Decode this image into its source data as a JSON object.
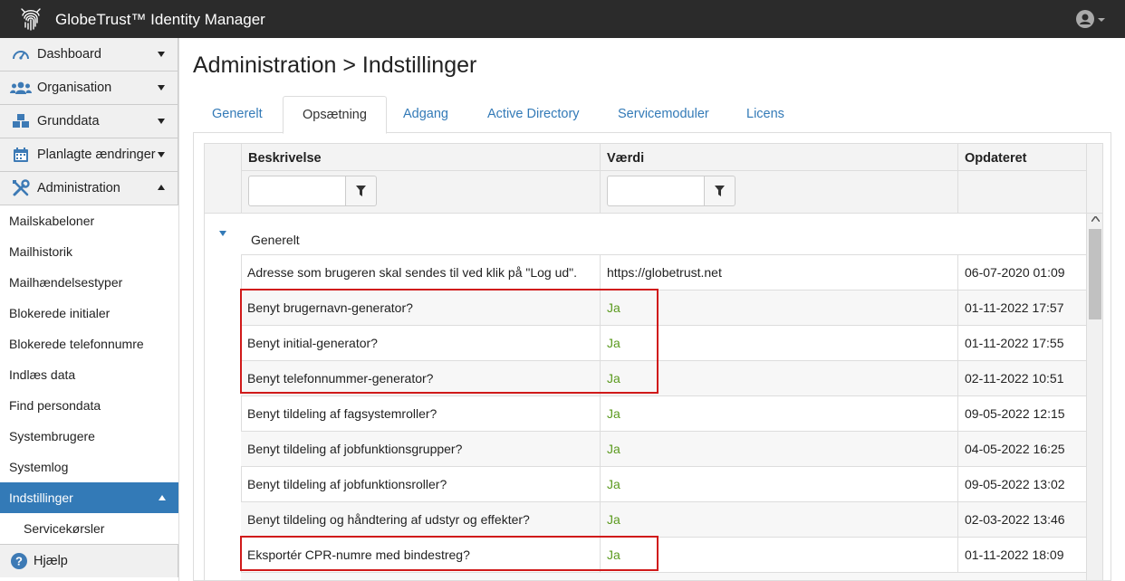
{
  "app": {
    "title": "GlobeTrust™ Identity Manager"
  },
  "sidebar": {
    "main_items": [
      {
        "label": "Dashboard",
        "icon": "gauge-icon"
      },
      {
        "label": "Organisation",
        "icon": "users-icon"
      },
      {
        "label": "Grunddata",
        "icon": "cubes-icon"
      },
      {
        "label": "Planlagte ændringer",
        "icon": "calendar-icon"
      },
      {
        "label": "Administration",
        "icon": "tools-icon"
      }
    ],
    "sub_items": [
      "Mailskabeloner",
      "Mailhistorik",
      "Mailhændelsestyper",
      "Blokerede initialer",
      "Blokerede telefonnumre",
      "Indlæs data",
      "Find persondata",
      "Systembrugere",
      "Systemlog",
      "Indstillinger"
    ],
    "subsub_items": [
      "Servicekørsler"
    ],
    "help_label": "Hjælp"
  },
  "page": {
    "title": "Administration > Indstillinger"
  },
  "tabs": [
    "Generelt",
    "Opsætning",
    "Adgang",
    "Active Directory",
    "Servicemoduler",
    "Licens"
  ],
  "active_tab": "Opsætning",
  "grid": {
    "columns": [
      "Beskrivelse",
      "Værdi",
      "Opdateret"
    ],
    "group": "Generelt",
    "rows": [
      {
        "desc": "Adresse som brugeren skal sendes til ved klik på \"Log ud\".",
        "value": "https://globetrust.net",
        "updated": "06-07-2020 01:09"
      },
      {
        "desc": "Benyt brugernavn-generator?",
        "value": "Ja",
        "updated": "01-11-2022 17:57"
      },
      {
        "desc": "Benyt initial-generator?",
        "value": "Ja",
        "updated": "01-11-2022 17:55"
      },
      {
        "desc": "Benyt telefonnummer-generator?",
        "value": "Ja",
        "updated": "02-11-2022 10:51"
      },
      {
        "desc": "Benyt tildeling af fagsystemroller?",
        "value": "Ja",
        "updated": "09-05-2022 12:15"
      },
      {
        "desc": "Benyt tildeling af jobfunktionsgrupper?",
        "value": "Ja",
        "updated": "04-05-2022 16:25"
      },
      {
        "desc": "Benyt tildeling af jobfunktionsroller?",
        "value": "Ja",
        "updated": "09-05-2022 13:02"
      },
      {
        "desc": "Benyt tildeling og håndtering af udstyr og effekter?",
        "value": "Ja",
        "updated": "02-03-2022 13:46"
      },
      {
        "desc": "Eksportér CPR-numre med bindestreg?",
        "value": "Ja",
        "updated": "01-11-2022 18:09"
      }
    ]
  },
  "colors": {
    "accent": "#337ab7",
    "ok": "#5b9a1e",
    "highlight": "#d01a1a",
    "topbar": "#2b2b2b"
  }
}
